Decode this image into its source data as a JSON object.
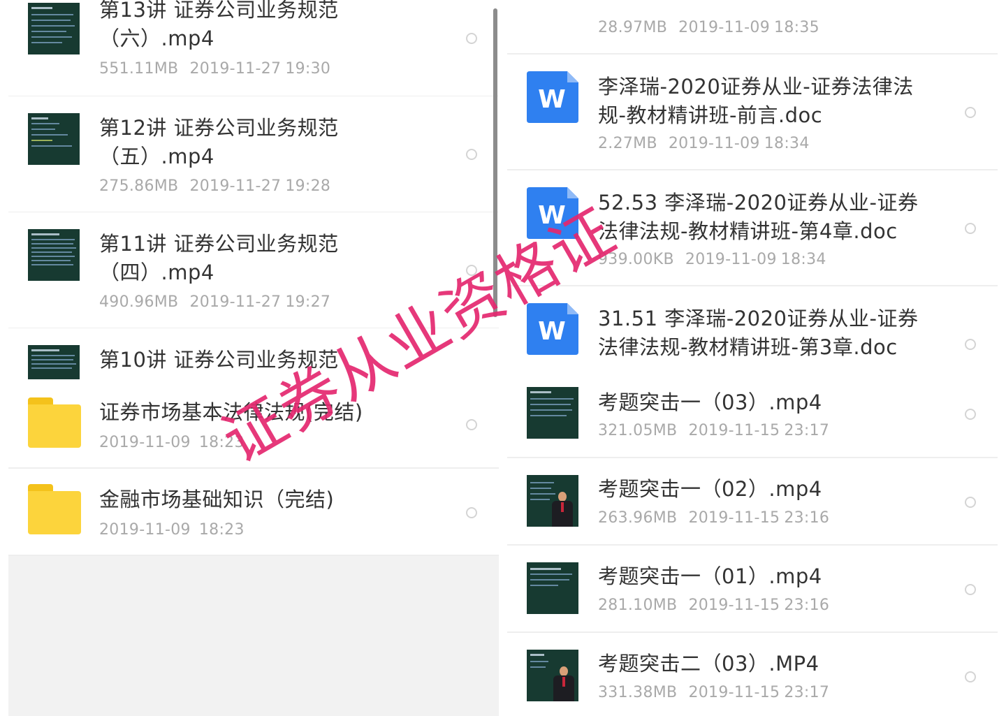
{
  "left_top": [
    {
      "title_line1": "第13讲 证券公司业务规范",
      "title_line2": "（六）.mp4",
      "size": "551.11MB",
      "date": "2019-11-27",
      "time": "19:30"
    },
    {
      "title_line1": "第12讲 证券公司业务规范",
      "title_line2": "（五）.mp4",
      "size": "275.86MB",
      "date": "2019-11-27",
      "time": "19:28"
    },
    {
      "title_line1": "第11讲 证券公司业务规范",
      "title_line2": "（四）.mp4",
      "size": "490.96MB",
      "date": "2019-11-27",
      "time": "19:27"
    },
    {
      "title_line1": "第10讲 证券公司业务规范"
    }
  ],
  "left_folders": [
    {
      "title": "证券市场基本法律法规(完结)",
      "date": "2019-11-09",
      "time": "18:23"
    },
    {
      "title": "金融市场基础知识（完结)",
      "date": "2019-11-09",
      "time": "18:23"
    }
  ],
  "right_top": {
    "partial": {
      "size": "28.97MB",
      "date": "2019-11-09",
      "time": "18:35"
    },
    "docs": [
      {
        "title_line1": "李泽瑞-2020证券从业-证券法律法",
        "title_line2": "规-教材精讲班-前言.doc",
        "size": "2.27MB",
        "date": "2019-11-09",
        "time": "18:34"
      },
      {
        "title_line1": "52.53 李泽瑞-2020证券从业-证券",
        "title_line2": "法律法规-教材精讲班-第4章.doc",
        "size": "939.00KB",
        "date": "2019-11-09",
        "time": "18:34"
      },
      {
        "title_line1": "31.51 李泽瑞-2020证券从业-证券",
        "title_line2": "法律法规-教材精讲班-第3章.doc"
      }
    ],
    "doc_icon_letter": "W"
  },
  "right_bottom": [
    {
      "title": "考题突击一（03）.mp4",
      "size": "321.05MB",
      "date": "2019-11-15",
      "time": "23:17"
    },
    {
      "title": "考题突击一（02）.mp4",
      "size": "263.96MB",
      "date": "2019-11-15",
      "time": "23:16"
    },
    {
      "title": "考题突击一（01）.mp4",
      "size": "281.10MB",
      "date": "2019-11-15",
      "time": "23:16"
    },
    {
      "title": "考题突击二（03）.MP4",
      "size": "331.38MB",
      "date": "2019-11-15",
      "time": "23:17"
    }
  ],
  "watermark": "证券从业资格证",
  "colors": {
    "folder": "#fcd43c",
    "doc_icon": "#2f80f0",
    "watermark": "#e4286f",
    "thumbnail_bg": "#173a31"
  }
}
